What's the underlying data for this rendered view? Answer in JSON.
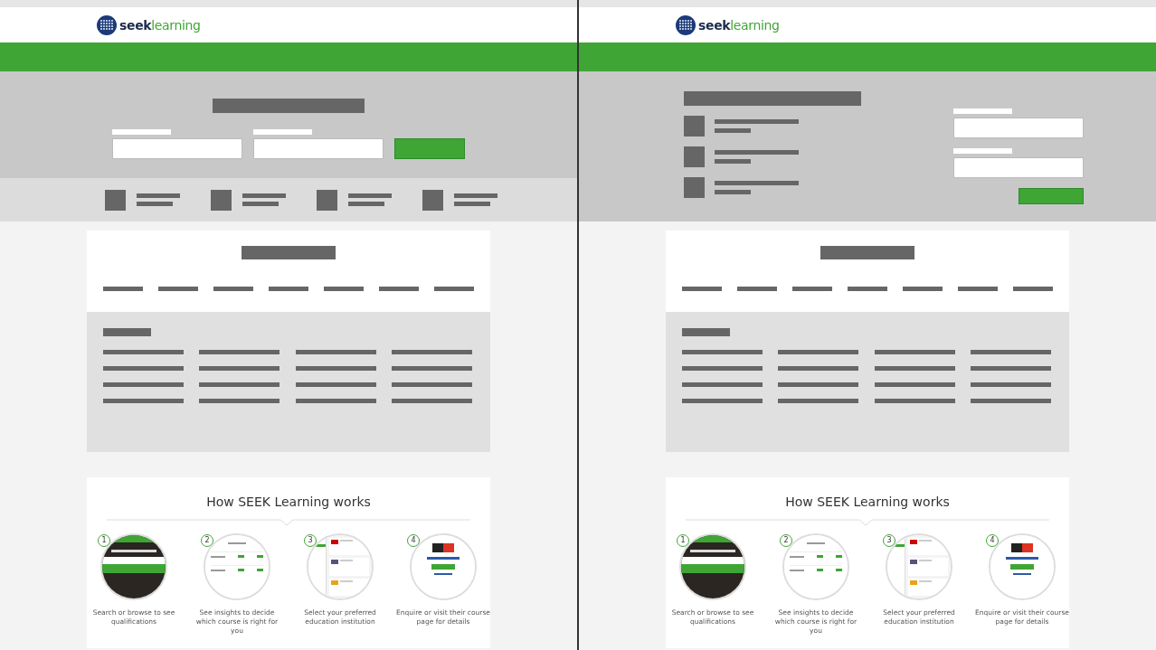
{
  "panels": [
    {
      "kind": "search-top",
      "logo": {
        "part_1": "seek",
        "part_2": "learning"
      },
      "how_it_works": {
        "title": "How SEEK Learning works",
        "steps": [
          {
            "number": "1",
            "kind": "search",
            "caption": "Search or browse to see qualifications"
          },
          {
            "number": "2",
            "kind": "insights",
            "caption": "See insights to decide which course is right for you"
          },
          {
            "number": "3",
            "kind": "list",
            "caption": "Select your preferred education institution"
          },
          {
            "number": "4",
            "kind": "institution",
            "caption": "Enquire or visit their course page for details"
          }
        ]
      }
    },
    {
      "kind": "form-right",
      "logo": {
        "part_1": "seek",
        "part_2": "learning"
      },
      "how_it_works": {
        "title": "How SEEK Learning works",
        "steps": [
          {
            "number": "1",
            "kind": "search",
            "caption": "Search or browse to see qualifications"
          },
          {
            "number": "2",
            "kind": "insights",
            "caption": "See insights to decide which course is right for you"
          },
          {
            "number": "3",
            "kind": "list",
            "caption": "Select your preferred education institution"
          },
          {
            "number": "4",
            "kind": "institution",
            "caption": "Enquire or visit their course page for details"
          }
        ]
      }
    }
  ]
}
